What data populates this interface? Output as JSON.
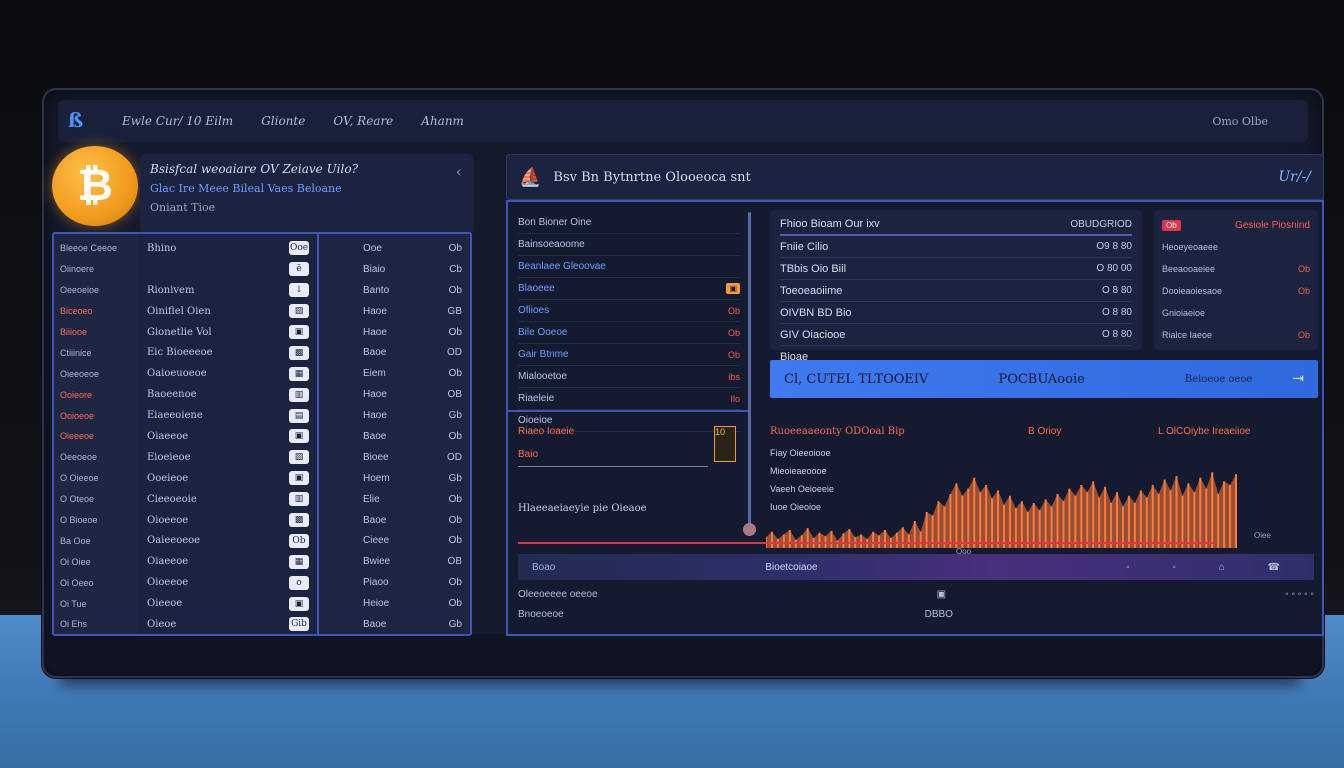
{
  "topbar": {
    "logo": "ß",
    "nav": [
      "Ewle Cur/ 10 Eilm",
      "Glionte",
      "OV, Reare",
      "Ahanm"
    ],
    "right": "Omo Olbe"
  },
  "coin": {
    "symbol": "₿"
  },
  "left_header": {
    "title": "Bsisfcal weoaiare OV Zeiave Uilo?",
    "subtitle": "Glac Ire Meee Bileal Vaes Beloane",
    "meta": "Oniant Tioe",
    "chevron": "‹"
  },
  "left_table": {
    "col_a": [
      {
        "t": "Bleeoe Ceeoe",
        "red": false
      },
      {
        "t": "Oiinoere",
        "red": false
      },
      {
        "t": "Oeeoeioe",
        "red": false
      },
      {
        "t": "Biceoeo",
        "red": true
      },
      {
        "t": "Biiiooe",
        "red": true
      },
      {
        "t": "Ctiiinice",
        "red": false
      },
      {
        "t": "Oieeoeoe",
        "red": false
      },
      {
        "t": "Ooieore",
        "red": true
      },
      {
        "t": "Ooioeoe",
        "red": true
      },
      {
        "t": "Oieeeoe",
        "red": true
      },
      {
        "t": "Oeeoeoe",
        "red": false
      },
      {
        "t": "O Oieeoe",
        "red": false
      },
      {
        "t": "O Oteoe",
        "red": false
      },
      {
        "t": "O Bioeoe",
        "red": false
      },
      {
        "t": "Ba Ooe",
        "red": false
      },
      {
        "t": "Oi Oiee",
        "red": false
      },
      {
        "t": "Oi Oeeo",
        "red": false
      },
      {
        "t": "Oi Tue",
        "red": false
      },
      {
        "t": "Oi Ehs",
        "red": false
      }
    ],
    "col_b": [
      {
        "t": "Bhino",
        "i": "Ooe"
      },
      {
        "t": "",
        "i": "ë"
      },
      {
        "t": "Rionivem",
        "i": "↓"
      },
      {
        "t": "Oiniflel Oien",
        "i": "▨"
      },
      {
        "t": "Gionetlie Vol",
        "i": "▣"
      },
      {
        "t": "Eic Bioeeeoe",
        "i": "▩"
      },
      {
        "t": "Oaioeuoeoe",
        "i": "▦"
      },
      {
        "t": "Baoeenoe",
        "i": "▥"
      },
      {
        "t": "Eiaeeoiene",
        "i": "▤"
      },
      {
        "t": "Oiaeeoe",
        "i": "▣"
      },
      {
        "t": "Eioeieoe",
        "i": "▨"
      },
      {
        "t": "Ooeieoe",
        "i": "▣"
      },
      {
        "t": "Cieeoeoie",
        "i": "▥"
      },
      {
        "t": "Oioeeoe",
        "i": "▩"
      },
      {
        "t": "Oaieeoeoe",
        "i": "Ob"
      },
      {
        "t": "Oiaeeoe",
        "i": "▦"
      },
      {
        "t": "Oioeeoe",
        "i": "o"
      },
      {
        "t": "Oieeoe",
        "i": "▣"
      },
      {
        "t": "Oieoe",
        "i": "Gib"
      }
    ],
    "col_c": [
      {
        "t": "Ooe",
        "v": "Ob"
      },
      {
        "t": "Biaio",
        "v": "Cb"
      },
      {
        "t": "Banto",
        "v": "Ob"
      },
      {
        "t": "Haoe",
        "v": "GB"
      },
      {
        "t": "Haoe",
        "v": "Ob"
      },
      {
        "t": "Baoe",
        "v": "OD"
      },
      {
        "t": "Eiem",
        "v": "Ob"
      },
      {
        "t": "Haoe",
        "v": "OB"
      },
      {
        "t": "Haoe",
        "v": "Gb"
      },
      {
        "t": "Baoe",
        "v": "Ob"
      },
      {
        "t": "Bioee",
        "v": "OD"
      },
      {
        "t": "Hoem",
        "v": "Gb"
      },
      {
        "t": "Elie",
        "v": "Ob"
      },
      {
        "t": "Baoe",
        "v": "Ob"
      },
      {
        "t": "Cieee",
        "v": "Ob"
      },
      {
        "t": "Bwiee",
        "v": "OB"
      },
      {
        "t": "Piaoo",
        "v": "Ob"
      },
      {
        "t": "Heioe",
        "v": "Ob"
      },
      {
        "t": "Baoe",
        "v": "Gb"
      }
    ]
  },
  "right_header": {
    "icon": "⛵",
    "title": "Bsv  Bn  Bytnrtne  Olooeoca snt",
    "right": "Ur/-/"
  },
  "orders": [
    {
      "l": "Bon Bioner Oine",
      "v": "",
      "blue": false
    },
    {
      "l": "Bainsoeaoome",
      "v": "",
      "blue": false
    },
    {
      "l": "Beanlaee Gleoovae",
      "v": "",
      "blue": true
    },
    {
      "l": "Blaoeee",
      "v": "▣",
      "blue": true
    },
    {
      "l": "Ofiioes",
      "v": "Ob",
      "blue": true
    },
    {
      "l": "Bile Ooeoe",
      "v": "Ob",
      "blue": true
    },
    {
      "l": "Gair Btnme",
      "v": "Ob",
      "blue": true
    },
    {
      "l": "Mialooetoe",
      "v": "ibs",
      "blue": false
    },
    {
      "l": "Riaeleie",
      "v": "Ilo",
      "blue": false
    },
    {
      "l": "Oioeioe",
      "v": "",
      "blue": false
    }
  ],
  "pairs": [
    {
      "n": "Fhioo Bioam Our ixv",
      "p": "OBUDGRIOD"
    },
    {
      "n": "Fniie Cilio",
      "p": "O9 8 80"
    },
    {
      "n": "TBbis Oio Biil",
      "p": "O 80 00"
    },
    {
      "n": "Toeoeaoiime",
      "p": "O 8 80"
    },
    {
      "n": "OIVBN BD Bio",
      "p": "O 8 80"
    },
    {
      "n": "GIV Oiaciooe",
      "p": "O 8 80"
    },
    {
      "n": "Bioae",
      "p": ""
    }
  ],
  "alerts": {
    "head": "Gesiole Piosnind",
    "tag": "Ob",
    "rows": [
      {
        "t": "Heoeyeoaeee",
        "r": ""
      },
      {
        "t": "Beeaooaeiee",
        "r": "Ob"
      },
      {
        "t": "Dooieaoiesaoe",
        "r": "Ob"
      },
      {
        "t": "Gnioiaeioe",
        "r": ""
      },
      {
        "t": "Rialce Iaeoe",
        "r": "Ob"
      }
    ]
  },
  "cta": {
    "a": "Cl, CUTEL TLTOOEIV",
    "b": "POCBUAooie",
    "c": "Beioeoe oeoe",
    "arrow": "⇥"
  },
  "chart_labels": {
    "title": "Ruoeeaaeonty ODOoal Bip",
    "mid": "B Orioy",
    "right": "L OlCOiybe Ireaeiioe",
    "legend": [
      "Fiay Oieeoiooe",
      "Mieoieaeoooe",
      "Vaeeh Oeioeeie",
      "Iuoe Oieoioe"
    ],
    "xlabel": "Ooo",
    "ylabel": "Oiee"
  },
  "bottom_left": {
    "t": "Riaeo Ioaeie",
    "t2": "Baio",
    "label": "Hlaeeaeiaeyie pie Oieaoe",
    "amber": "10"
  },
  "tray": {
    "a": "Boao",
    "mid": "Bioetcoiaoe",
    "icons": "◦ ◦ ⌂ ☎"
  },
  "footer": [
    {
      "t": "Oleeoeeee oeeoe",
      "v": "▣",
      "x": "◦ ◦ ◦ ◦ ◦"
    },
    {
      "t": "Bnoeoeoe",
      "v": "DBBO",
      "x": ""
    }
  ],
  "colors": {
    "accent": "#3f7af0",
    "bitcoin": "#f29b1c",
    "danger": "#e0344b",
    "orange": "#ff7a3a"
  },
  "chart_data": {
    "type": "area",
    "x": [
      0,
      1,
      2,
      3,
      4,
      5,
      6,
      7,
      8,
      9,
      10,
      11,
      12,
      13,
      14,
      15,
      16,
      17,
      18,
      19,
      20,
      21,
      22,
      23,
      24,
      25,
      26,
      27,
      28,
      29,
      30,
      31,
      32,
      33,
      34,
      35,
      36,
      37,
      38,
      39,
      40,
      41,
      42,
      43,
      44,
      45,
      46,
      47,
      48,
      49,
      50,
      51,
      52,
      53,
      54,
      55,
      56,
      57,
      58,
      59,
      60,
      61,
      62,
      63,
      64,
      65,
      66,
      67,
      68,
      69,
      70,
      71,
      72,
      73,
      74,
      75,
      76,
      77,
      78,
      79
    ],
    "series": [
      {
        "values": [
          12,
          18,
          10,
          15,
          20,
          9,
          14,
          22,
          11,
          17,
          13,
          19,
          8,
          16,
          21,
          12,
          15,
          10,
          18,
          14,
          20,
          11,
          17,
          23,
          15,
          30,
          18,
          40,
          36,
          52,
          46,
          60,
          72,
          58,
          66,
          78,
          62,
          70,
          55,
          64,
          48,
          58,
          44,
          52,
          40,
          50,
          42,
          54,
          46,
          60,
          52,
          66,
          58,
          70,
          62,
          74,
          56,
          68,
          50,
          62,
          46,
          58,
          50,
          64,
          56,
          70,
          60,
          76,
          64,
          80,
          58,
          72,
          62,
          78,
          66,
          84,
          60,
          74,
          70,
          82
        ]
      }
    ],
    "ylim": [
      0,
      100
    ]
  }
}
